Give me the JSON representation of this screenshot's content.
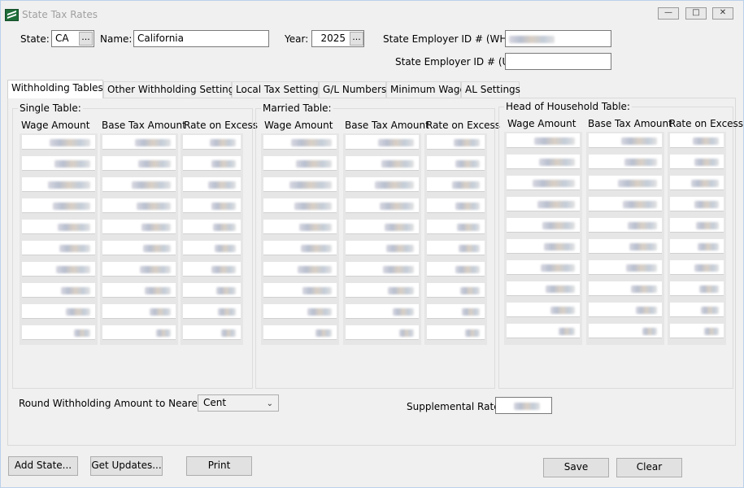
{
  "window": {
    "title": "State Tax Rates"
  },
  "header": {
    "state_label": "State:",
    "state_value": "CA",
    "name_label": "Name:",
    "name_value": "California",
    "year_label": "Year:",
    "year_value": "2025",
    "ellipsis": "...",
    "employer_wht_label": "State Employer ID # (WHT):",
    "employer_ui_label": "State Employer ID # (UI):"
  },
  "tabs": [
    "Withholding Tables",
    "Other Withholding Settings",
    "Local Tax Settings",
    "G/L Numbers",
    "Minimum Wage",
    "AL Settings"
  ],
  "tables": {
    "single": {
      "title": "Single Table:"
    },
    "married": {
      "title": "Married Table:"
    },
    "head": {
      "title": "Head of Household Table:"
    },
    "columns": [
      "Wage Amount",
      "Base Tax Amount",
      "Rate on Excess"
    ]
  },
  "round": {
    "label": "Round Withholding Amount to Nearest:",
    "value": "Cent"
  },
  "supplemental": {
    "label": "Supplemental Rate:"
  },
  "buttons": {
    "add_state": "Add State...",
    "get_updates": "Get Updates...",
    "print": "Print",
    "save": "Save",
    "clear": "Clear"
  }
}
